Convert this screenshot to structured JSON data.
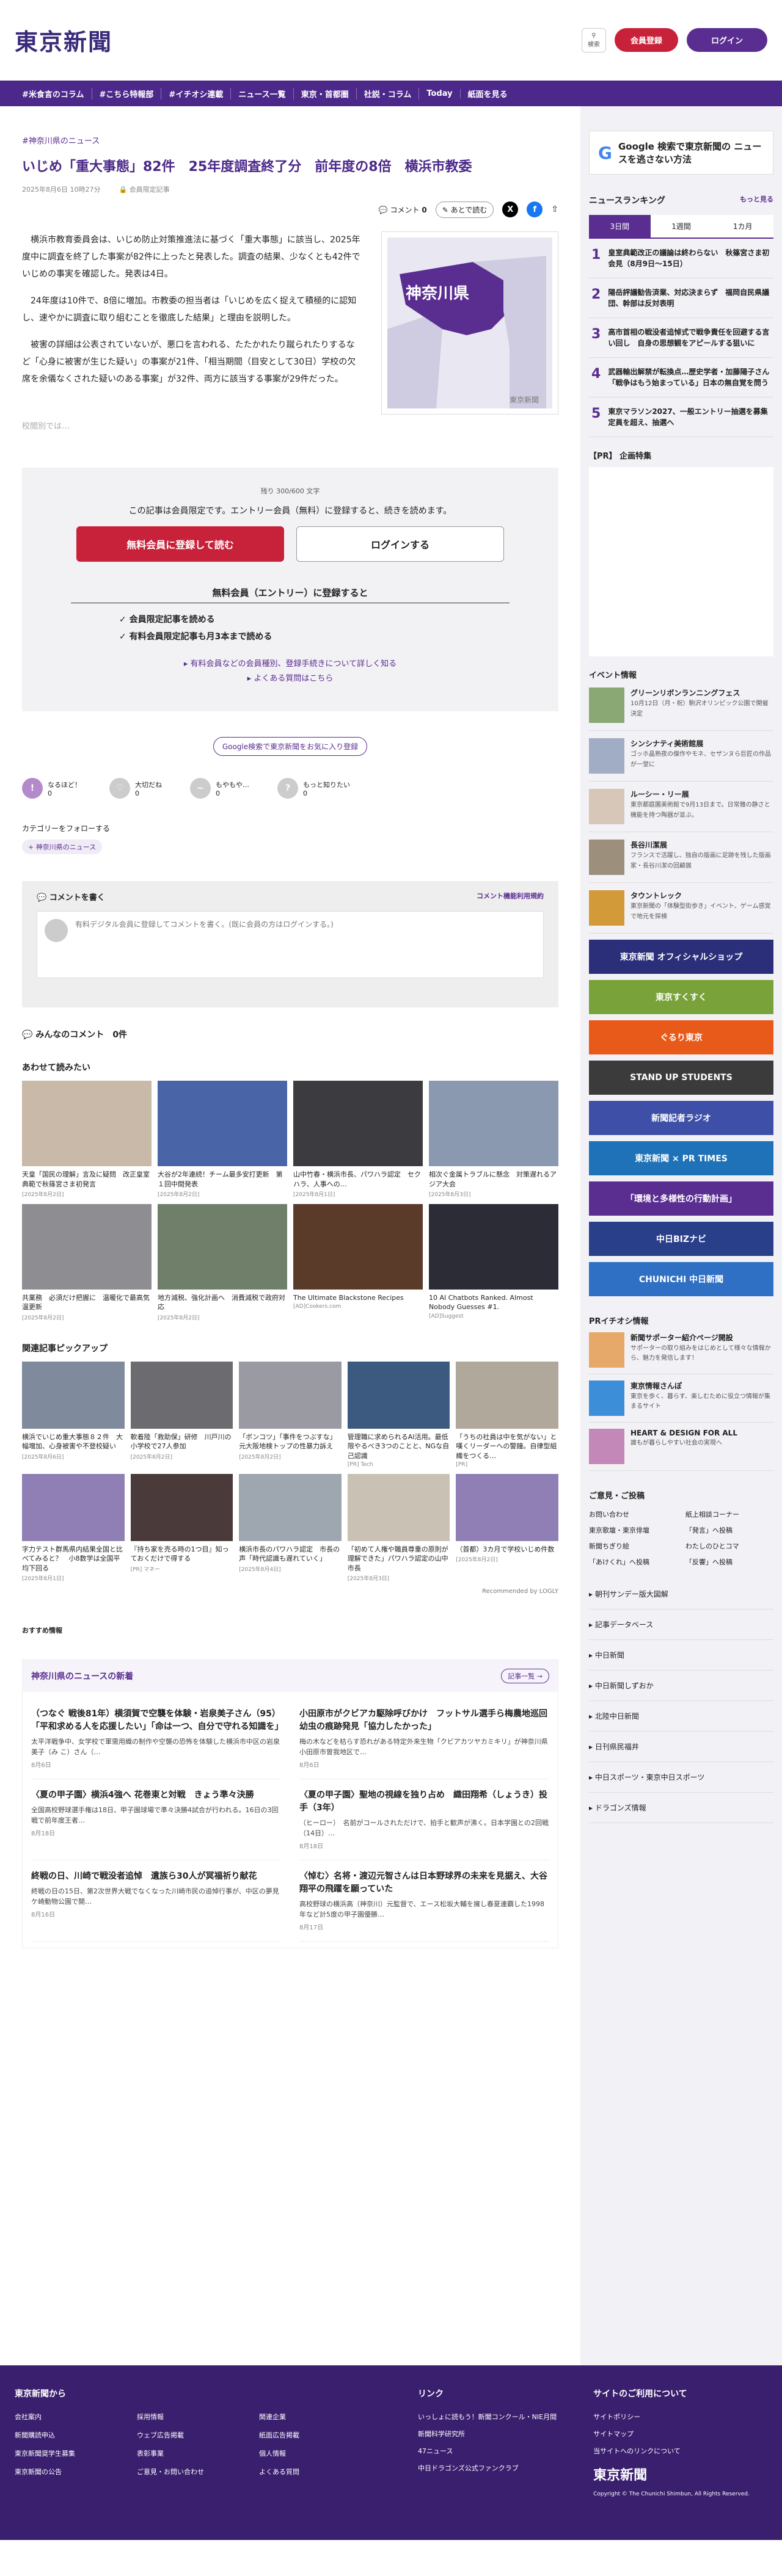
{
  "header": {
    "logo": "東京新聞",
    "search_label": "検索",
    "register_label": "会員登録",
    "login_label": "ログイン"
  },
  "nav": [
    "#米食言のコラム",
    "#こちら特報部",
    "#イチオシ連載",
    "ニュース一覧",
    "東京・首都圏",
    "社説・コラム",
    "Today",
    "紙面を見る"
  ],
  "article": {
    "breadcrumb": "#神奈川県のニュース",
    "title": "いじめ「重大事態」82件　25年度調査終了分　前年度の8倍　横浜市教委",
    "date": "2025年8月6日 10時27分",
    "member_tag": "会員限定記事",
    "comment_label": "コメント",
    "comment_count": "0",
    "bookmark_label": "あとで読む",
    "map_label": "神奈川県",
    "map_credit": "東京新聞",
    "paragraphs": [
      "横浜市教育委員会は、いじめ防止対策推進法に基づく「重大事態」に該当し、2025年度中に調査を終了した事案が82件に上ったと発表した。調査の結果、少なくとも42件でいじめの事実を確認した。発表は4日。",
      "24年度は10件で、8倍に増加。市教委の担当者は「いじめを広く捉えて積極的に認知し、速やかに調査に取り組むことを徹底した結果」と理由を説明した。",
      "被害の詳細は公表されていないが、悪口を言われる、たたかれたり蹴られたりするなど「心身に被害が生じた疑い」の事案が21件、「相当期間（目安として30日）学校の欠席を余儀なくされた疑いのある事案」が32件、両方に該当する事案が29件だった。"
    ],
    "cut_notice": "校閲別では…"
  },
  "paywall": {
    "remaining": "残り 300/600 文字",
    "lead": "この記事は会員限定です。エントリー会員（無料）に登録すると、続きを読めます。",
    "register_button": "無料会員に登録して読む",
    "login_button": "ログインする",
    "benefit_title": "無料会員（エントリー）に登録すると",
    "benefits": [
      "会員限定記事を読める",
      "有料会員限定記事も月3本まで読める"
    ],
    "link1": "有料会員などの会員種別、登録手続きについて詳しく知る",
    "link2": "よくある質問はこちら",
    "google_fav": "Google検索で東京新聞をお気に入り登録"
  },
  "reactions": [
    {
      "label": "なるほど！",
      "count": "0",
      "color": "#b58acb"
    },
    {
      "label": "大切だね",
      "count": "0",
      "color": "#bbbbbb"
    },
    {
      "label": "もやもや…",
      "count": "0",
      "color": "#bbbbbb"
    },
    {
      "label": "もっと知りたい",
      "count": "0",
      "color": "#bbbbbb"
    }
  ],
  "follow": {
    "label": "カテゴリーをフォローする",
    "tag": "+ 神奈川県のニュース"
  },
  "comments": {
    "box_title": "コメントを書く",
    "rules": "コメント機能利用規約",
    "input_text": "有料デジタル会員に登録してコメントを書く。(既に会員の方はログインする。)",
    "list_title": "みんなのコメント",
    "list_count": "0件"
  },
  "recommend": {
    "title": "あわせて読みたい",
    "items": [
      {
        "cap": "天皇「国民の理解」言及に疑問　改正皇室典範で秋篠宮さま初発言",
        "src": "[2025年8月2日]"
      },
      {
        "cap": "大谷が2年連続！チーム最多安打更新　第１回中間発表",
        "src": "[2025年8月2日]"
      },
      {
        "cap": "山中竹春・横浜市長、パワハラ認定　セクハラ、人事への…",
        "src": "[2025年8月1日]"
      },
      {
        "cap": "相次ぐ金属トラブルに懸念　対策遅れるアジア大会",
        "src": "[2025年8月3日]"
      },
      {
        "cap": "共業務　必須だけ把握に　温暖化で最高気温更新",
        "src": "[2025年8月2日]"
      },
      {
        "cap": "地方減税、強化計画へ　消費減税で政府対応",
        "src": "[2025年8月2日]"
      },
      {
        "cap": "The Ultimate Blackstone Recipes",
        "src": "[AD]Cookers.com"
      },
      {
        "cap": "10 AI Chatbots Ranked. Almost Nobody Guesses #1.",
        "src": "[AD]Suggest"
      }
    ]
  },
  "pickup": {
    "title": "関連記事ピックアップ",
    "items": [
      {
        "cap": "横浜でいじめ重大事態８２件　大幅増加、心身被害や不登校疑い",
        "src": "[2025年8月6日]"
      },
      {
        "cap": "軟着陸「救助保」研修　川戸川の小学校で27人参加",
        "src": "[2025年8月2日]"
      },
      {
        "cap": "「ボンコツ」「事件をつぶすな」元大阪地検トップの性暴力訴え",
        "src": "[2025年8月2日]"
      },
      {
        "cap": "管理職に求められるAI活用。最低限やるべき3つのことと、NGな自己認識",
        "src": "[PR] Tech"
      },
      {
        "cap": "「うちの社員は中を気がない」と嘆くリーダーへの警鐘。自律型組織をつくる…",
        "src": "[PR]"
      },
      {
        "cap": "字力テスト群馬県内結果全国と比べてみると？　小8数学は全国平均下回る",
        "src": "[2025年8月1日]"
      },
      {
        "cap": "『持ち家を売る時の1つ目』知っておくだけで得する",
        "src": "[PR] マネー"
      },
      {
        "cap": "横浜市長のパワハラ認定　市長の声「時代認識も遅れていく」",
        "src": "[2025年8月4日]"
      },
      {
        "cap": "「初めて人権や職員尊重の原則が理解できた」パワハラ認定の山中市長",
        "src": "[2025年8月3日]"
      },
      {
        "cap": "（首都）3カ月で学校いじめ件数",
        "src": "[2025年8月2日]"
      }
    ]
  },
  "recommended_by": "Recommended by LOGLY",
  "news_section": {
    "label": "おすすめ情報",
    "title": "神奈川県のニュースの新着",
    "more": "記事一覧",
    "items": [
      {
        "title": "（つなぐ 戦後81年）横須賀で空襲を体験・岩泉美子さん（95）「平和求める人を応援したい」「命は一つ、自分で守れる知識を」",
        "body": "太平洋戦争中、女学校で軍需用織の制作や空襲の恐怖を体験した横浜市中区の岩泉美子（み こ）さん（…",
        "date": "8月6日"
      },
      {
        "title": "小田原市がクビアカ駆除呼びかけ　フットサル選手ら梅農地巡回　幼虫の痕跡発見「協力したかった」",
        "body": "梅の木などを枯らす恐れがある特定外来生物「クビアカツヤカミキリ」が神奈川県小田原市曽我地区で…",
        "date": "8月6日"
      },
      {
        "title": "〈夏の甲子園〉横浜4強へ 花巻東と対戦　きょう準々決勝",
        "body": "全国高校野球選手権は18日、甲子園球場で準々決勝4試合が行われる。16日の3回戦で前年度王者…",
        "date": "8月18日"
      },
      {
        "title": "〈夏の甲子園〉聖地の視線を独り占め　織田翔希（しょうき）投手（3年）",
        "body": "（ヒーロー）　名前がコールされただけで、拍手と歓声が沸く。日本学園との2回戦（14日）…",
        "date": "8月18日"
      },
      {
        "title": "終戦の日、川崎で戦没者追悼　遺族ら30人が冥福祈り献花",
        "body": "終戦の日の15日、第2次世界大戦でなくなった川崎市民の追悼行事が、中区の夢見ケ崎動物公園で開…",
        "date": "8月16日"
      },
      {
        "title": "〈悼む〉名将・渡辺元智さんは日本野球界の未来を見据え、大谷翔平の飛躍を願っていた",
        "body": "高校野球の横浜高（神奈川）元監督で、エース松坂大輔を擁し春夏連覇した1998年など計5度の甲子園優勝…",
        "date": "8月17日"
      }
    ]
  },
  "sidebar": {
    "google_box": "Google 検索で東京新聞の ニュースを逃さない方法",
    "ranking_title": "ニュースランキング",
    "ranking_more": "もっと見る",
    "tabs": [
      "3日間",
      "1週間",
      "1カ月"
    ],
    "ranking": [
      {
        "n": "1",
        "t": "皇室典範改正の議論は終わらない　秋篠宮さま初会見（8月9日〜15日）"
      },
      {
        "n": "2",
        "t": "陽岳評議勧告済業、対応決まらず　福岡自民県議団、幹部は反対表明"
      },
      {
        "n": "3",
        "t": "高市首相の戦没者追悼式で戦争責任を回避する言い回し　自身の思想観をアピールする狙いに"
      },
      {
        "n": "4",
        "t": "武器輸出解禁が転換点…歴史学者・加藤陽子さん「戦争はもう始まっている」日本の無自覚を問う"
      },
      {
        "n": "5",
        "t": "東京マラソン2027、一般エントリー抽選を募集定員を超え、抽選へ"
      }
    ],
    "pr_title": "【PR】 企画特集",
    "events_title": "イベント情報",
    "events": [
      {
        "t": "グリーンリボンランニングフェス",
        "d": "10月12日（月・祝）駒沢オリンピック公園で開催決定",
        "c": "#8aa873"
      },
      {
        "t": "シンシナティ美術館展",
        "d": "ゴッホ晶熟夜の傑作やモネ、セザンヌら巨匠の作品が一堂に",
        "c": "#a0adc4"
      },
      {
        "t": "ルーシー・リー展",
        "d": "東京都庭園美術館で9月13日まで。日常雅の静さと機能を持つ陶器が並ぶ。",
        "c": "#d7c7b8"
      },
      {
        "t": "長谷川潔展",
        "d": "フランスで活躍し、独自の版画に足跡を残した版画家・長谷川潔の回顧展",
        "c": "#9c8f7c"
      },
      {
        "t": "タウントレック",
        "d": "東京新聞の「体験型街歩き」イベント、ゲーム感覚で地元を探検",
        "c": "#d39a3a"
      }
    ],
    "banners": [
      {
        "t": "東京新聞 オフィシャルショップ",
        "c": "#2b2f7a"
      },
      {
        "t": "東京すくすく",
        "c": "#7aa23a"
      },
      {
        "t": "ぐるり東京",
        "c": "#e85a1a"
      },
      {
        "t": "STAND UP STUDENTS",
        "c": "#3b3b3b"
      },
      {
        "t": "新聞記者ラジオ",
        "c": "#3e4fa7"
      },
      {
        "t": "東京新聞 × PR TIMES",
        "c": "#1f72b8"
      },
      {
        "t": "「環境と多様性の行動計画」",
        "c": "#5a2d91"
      },
      {
        "t": "中日BIZナビ",
        "c": "#2a3f8a"
      },
      {
        "t": "CHUNICHI 中日新聞",
        "c": "#2f6fc4"
      }
    ],
    "pri_title": "PRイチオシ情報",
    "pri": [
      {
        "t": "新聞サポーター紹介ページ開設",
        "d": "サポーターの取り組みをはじめとして様々な情報から、魅力を発信します！"
      },
      {
        "t": "東京情報さんぽ",
        "d": "東京を歩く、暮らす、楽しむために役立つ情報が集まるサイト"
      },
      {
        "t": "HEART & DESIGN FOR ALL",
        "d": "誰もが暮らしやすい社会の実現へ"
      }
    ],
    "opinion_title": "ご意見・ご投稿",
    "opinion_links": [
      "お問い合わせ",
      "紙上相談コーナー",
      "東京歌壇・東京俳壇",
      "「発言」へ投稿",
      "新聞ちぎり絵",
      "わたしのひとコマ",
      "「あけくれ」へ投稿",
      "「反響」へ投稿"
    ],
    "arrow_links": [
      "朝刊サンデー版大図解",
      "記事データベース",
      "中日新聞",
      "中日新聞しずおか",
      "北陸中日新聞",
      "日刊県民福井",
      "中日スポーツ・東京中日スポーツ",
      "ドラゴンズ情報"
    ]
  },
  "footer": {
    "col1_title": "東京新聞から",
    "col1": [
      "会社案内",
      "採用情報",
      "関連企業",
      "新聞購読申込",
      "ウェブ広告掲載",
      "紙面広告掲載",
      "東京新聞奨学生募集",
      "表彰事業",
      "個人情報",
      "東京新聞の公告",
      "ご意見・お問い合わせ",
      "よくある質問"
    ],
    "col2_title": "リンク",
    "col2": [
      "いっしょに読もう！新聞コンクール・NIE月間",
      "新聞科学研究所",
      "47ニュース",
      "中日ドラゴンズ公式ファンクラブ"
    ],
    "col3_title": "サイトのご利用について",
    "col3": [
      "サイトポリシー",
      "サイトマップ",
      "当サイトへのリンクについて"
    ],
    "logo": "東京新聞",
    "copyright": "Copyright © The Chunichi Shimbun, All Rights Reserved."
  }
}
